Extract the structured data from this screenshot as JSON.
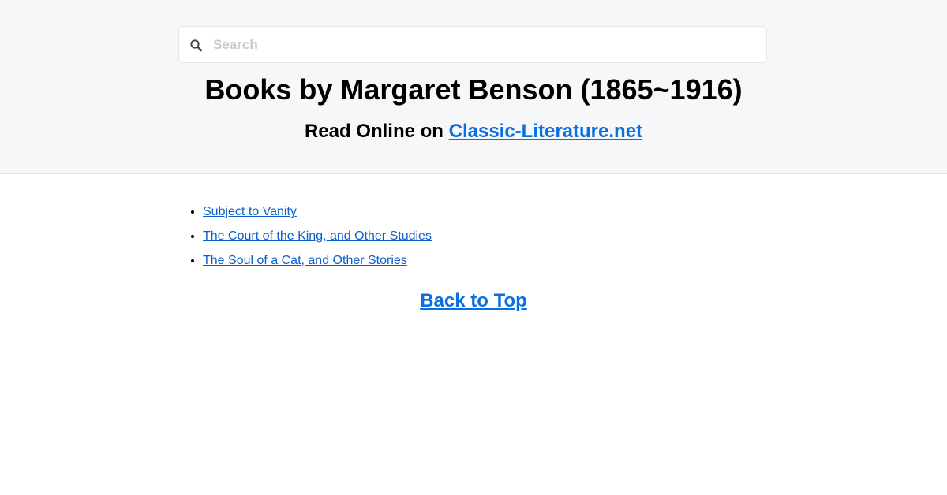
{
  "search": {
    "placeholder": "Search",
    "icon": "search-icon"
  },
  "header": {
    "title": "Books by Margaret Benson (1865~1916)",
    "subtitle_prefix": "Read Online on ",
    "site_link": "Classic-Literature.net"
  },
  "books": [
    {
      "title": "Subject to Vanity"
    },
    {
      "title": "The Court of the King, and Other Studies"
    },
    {
      "title": "The Soul of a Cat, and Other Stories"
    }
  ],
  "footer": {
    "back_to_top": "Back to Top"
  },
  "colors": {
    "header_bg": "#f6f7f9",
    "link": "#0b6fe0",
    "list_link": "#0b5fcc"
  }
}
